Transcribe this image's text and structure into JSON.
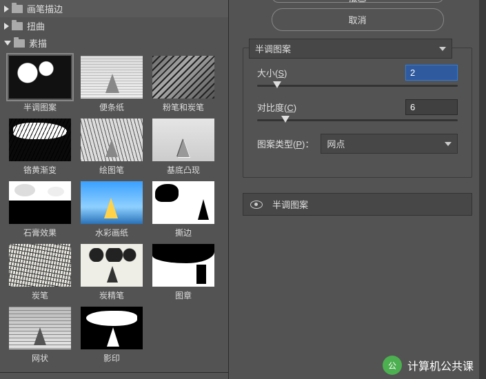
{
  "sidebar": {
    "categories": [
      {
        "label": "画笔描边",
        "expanded": false
      },
      {
        "label": "扭曲",
        "expanded": false
      },
      {
        "label": "素描",
        "expanded": true
      }
    ],
    "items": [
      {
        "label": "半调图案"
      },
      {
        "label": "便条纸"
      },
      {
        "label": "粉笔和炭笔"
      },
      {
        "label": "铬黄渐变"
      },
      {
        "label": "绘图笔"
      },
      {
        "label": "基底凸现"
      },
      {
        "label": "石膏效果"
      },
      {
        "label": "水彩画纸"
      },
      {
        "label": "撕边"
      },
      {
        "label": "炭笔"
      },
      {
        "label": "炭精笔"
      },
      {
        "label": "图章"
      },
      {
        "label": "网状"
      },
      {
        "label": "影印"
      }
    ],
    "selected_index": 0
  },
  "buttons": {
    "ok": "确定",
    "cancel": "取消"
  },
  "filter_dropdown": {
    "selected": "半调图案"
  },
  "params": {
    "size": {
      "label": "大小(S)",
      "value": "2",
      "knob_pct": 8
    },
    "contrast": {
      "label": "对比度(C)",
      "value": "6",
      "knob_pct": 12
    },
    "pattern_type": {
      "label": "图案类型(P)：",
      "value": "网点"
    }
  },
  "layer": {
    "name": "半调图案"
  },
  "watermark": {
    "text": "计算机公共课",
    "badge": "公"
  }
}
